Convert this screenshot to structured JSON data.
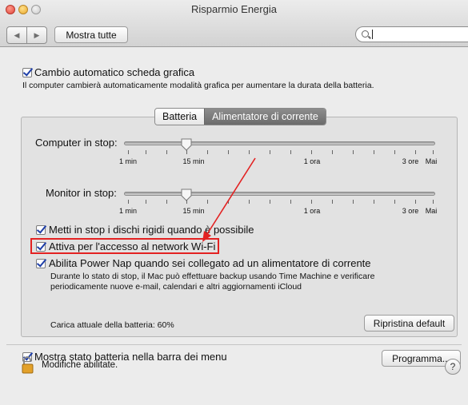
{
  "window": {
    "title": "Risparmio Energia"
  },
  "toolbar": {
    "back_icon": "back-arrow",
    "forward_icon": "forward-arrow",
    "show_all": "Mostra tutte",
    "search_value": ""
  },
  "auto_switch": {
    "label": "Cambio automatico scheda grafica",
    "description": "Il computer cambierà automaticamente modalità grafica per aumentare la durata della batteria.",
    "checked": true
  },
  "tabs": [
    {
      "label": "Batteria",
      "selected": true
    },
    {
      "label": "Alimentatore di corrente",
      "selected": false
    }
  ],
  "sliders": {
    "computer": {
      "label": "Computer in stop:",
      "value": "15 min"
    },
    "monitor": {
      "label": "Monitor in stop:",
      "value": "15 min"
    },
    "tick_labels": [
      "1 min",
      "15 min",
      "1 ora",
      "3 ore",
      "Mai"
    ]
  },
  "options": [
    {
      "label": "Metti in stop i dischi rigidi quando è possibile",
      "checked": true
    },
    {
      "label": "Attiva per l'accesso al network Wi-Fi",
      "checked": true
    },
    {
      "label": "Abilita Power Nap quando sei collegato ad un alimentatore di corrente",
      "checked": true
    }
  ],
  "power_nap_description": [
    "Durante lo stato di stop, il Mac può effettuare backup usando Time Machine e verificare",
    "periodicamente nuove e-mail, calendari e altri aggiornamenti iCloud"
  ],
  "battery_charge": "Carica attuale della batteria: 60%",
  "restore_button": "Ripristina default",
  "menu_bar_status": {
    "label": "Mostra stato batteria nella barra dei menu",
    "checked": true
  },
  "schedule_button": "Programma...",
  "lock_status": "Modifiche abilitate.",
  "help_label": "?",
  "colors": {
    "accent": "#1f3fa8",
    "annotation": "#e32222"
  }
}
